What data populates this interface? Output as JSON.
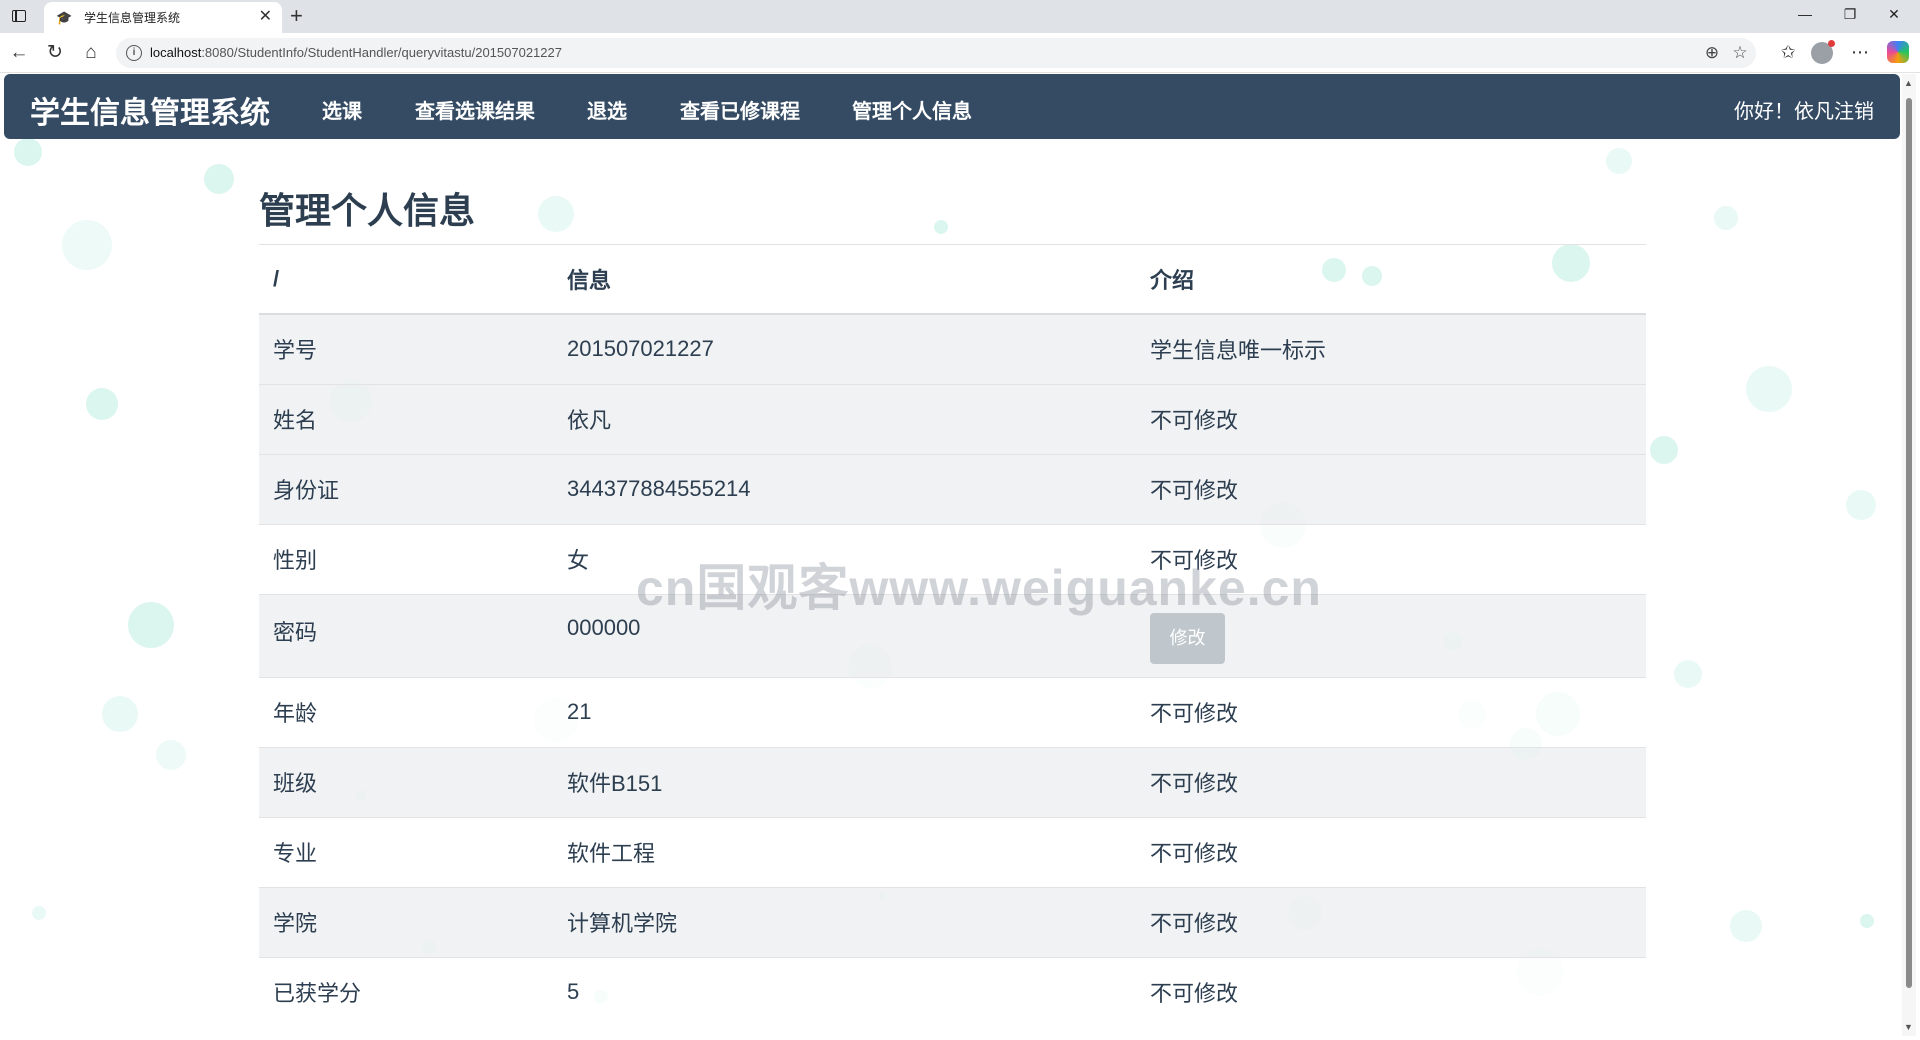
{
  "browser": {
    "tab_title": "学生信息管理系统",
    "tab_close": "✕",
    "new_tab": "+",
    "url_host": "localhost",
    "url_rest": ":8080/StudentInfo/StudentHandler/queryvitastu/201507021227"
  },
  "navbar": {
    "brand": "学生信息管理系统",
    "items": [
      "选课",
      "查看选课结果",
      "退选",
      "查看已修课程",
      "管理个人信息"
    ],
    "greeting": "你好！依凡注销"
  },
  "page": {
    "title": "管理个人信息",
    "headers": [
      "/",
      "信息",
      "介绍"
    ],
    "rows": [
      {
        "label": "学号",
        "value": "201507021227",
        "note": "学生信息唯一标示"
      },
      {
        "label": "姓名",
        "value": "依凡",
        "note": "不可修改"
      },
      {
        "label": "身份证",
        "value": "344377884555214",
        "note": "不可修改"
      },
      {
        "label": "性别",
        "value": "女",
        "note": "不可修改"
      },
      {
        "label": "密码",
        "value": "000000",
        "note": "修改"
      },
      {
        "label": "年龄",
        "value": "21",
        "note": "不可修改"
      },
      {
        "label": "班级",
        "value": "软件B151",
        "note": "不可修改"
      },
      {
        "label": "专业",
        "value": "软件工程",
        "note": "不可修改"
      },
      {
        "label": "学院",
        "value": "计算机学院",
        "note": "不可修改"
      },
      {
        "label": "已获学分",
        "value": "5",
        "note": "不可修改"
      }
    ]
  },
  "watermark": "cn国观客www.weiguanke.cn",
  "colors": {
    "navbar_bg": "#344b63",
    "title_text": "#2c3e50",
    "button_bg": "#bfc7cd",
    "bubble": "#a0e4d6"
  }
}
